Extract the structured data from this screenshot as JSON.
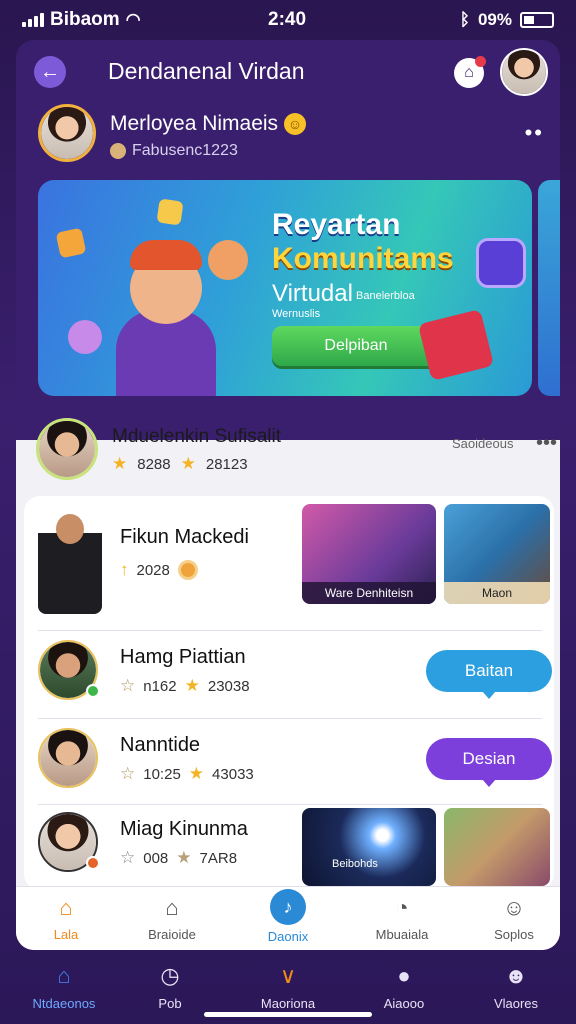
{
  "status_bar": {
    "carrier": "Bibaom",
    "time": "2:40",
    "battery": "09%"
  },
  "header": {
    "title": "Dendanenal Virdan"
  },
  "profile": {
    "name": "Merloyea Nimaeis",
    "subtitle": "Fabusenc1223"
  },
  "banner": {
    "title_line1": "Reyartan",
    "title_line2": "Komunitams",
    "title_line3": "Virtudal",
    "small_text": "Banelerbloa",
    "small_text_2": "Wernuslis",
    "button_label": "Delpiban"
  },
  "community": {
    "title": "Mduelenkin Sufisalit",
    "stat1": "8288",
    "stat2": "28123",
    "more_label": "Saoideous"
  },
  "entries": [
    {
      "name": "Fikun Mackedi",
      "stat1": "2028"
    },
    {
      "name": "Hamg Piattian",
      "stat1": "n162",
      "stat2": "23038",
      "button": "Baitan"
    },
    {
      "name": "Nanntide",
      "stat1": "10:25",
      "stat2": "43033",
      "button": "Desian"
    },
    {
      "name": "Miag Kinunma",
      "stat1": "008",
      "stat2": "7AR8"
    }
  ],
  "thumbnails": {
    "t1_caption": "Ware Denhiteisn",
    "t2_caption": "Maon",
    "t3_caption": "Beibohds"
  },
  "inner_nav": [
    {
      "label": "Lala",
      "icon": "home-icon",
      "color": "#f08a1e"
    },
    {
      "label": "Braioide",
      "icon": "house-outline-icon"
    },
    {
      "label": "Daonix",
      "icon": "music-icon"
    },
    {
      "label": "Mbuaiala",
      "icon": "chat-icon"
    },
    {
      "label": "Soplos",
      "icon": "user-icon"
    }
  ],
  "bottom_nav": [
    {
      "label": "Ntdaeonos",
      "icon": "home-icon",
      "color": "#3a7ee8"
    },
    {
      "label": "Pob",
      "icon": "clock-icon"
    },
    {
      "label": "Maoriona",
      "icon": "v-icon",
      "color": "#f08a1e"
    },
    {
      "label": "Aiaooo",
      "icon": "chat-bubble-icon"
    },
    {
      "label": "Vlaores",
      "icon": "user-icon"
    }
  ]
}
